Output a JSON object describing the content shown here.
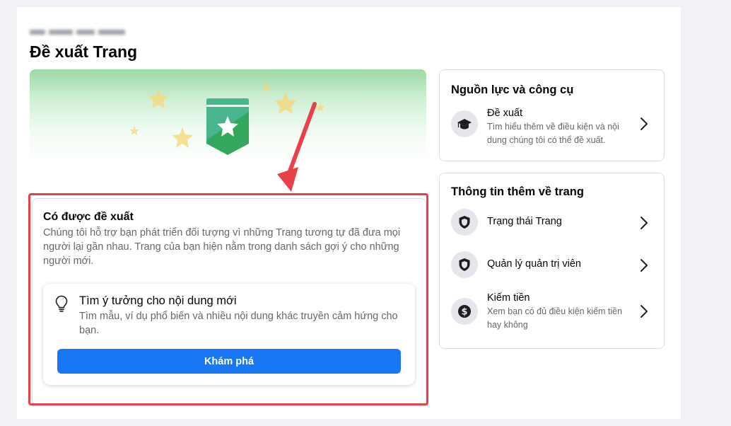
{
  "page": {
    "title": "Đề xuất Trang"
  },
  "main_card": {
    "heading": "Có được đề xuất",
    "description": "Chúng tôi hỗ trợ bạn phát triển đối tượng vì những Trang tương tự đã đưa mọi người lại gần nhau. Trang của bạn hiện nằm trong danh sách gợi ý cho những người mới.",
    "idea": {
      "icon": "lightbulb-icon",
      "title": "Tìm ý tưởng cho nội dung mới",
      "description": "Tìm mẫu, ví dụ phổ biến và nhiều nội dung khác truyền cảm hứng cho bạn.",
      "button_label": "Khám phá"
    }
  },
  "resources_card": {
    "title": "Nguồn lực và công cụ",
    "items": [
      {
        "label": "Đề xuất",
        "description": "Tìm hiểu thêm về điều kiện và nội dung chúng tôi có thể đề xuất.",
        "icon": "graduation-cap-icon"
      }
    ]
  },
  "info_card": {
    "title": "Thông tin thêm về trang",
    "items": [
      {
        "label": "Trạng thái Trang",
        "icon": "shield-icon"
      },
      {
        "label": "Quản lý quản trị viên",
        "icon": "shield-icon"
      },
      {
        "label": "Kiếm tiền",
        "description": "Xem bạn có đủ điều kiện kiếm tiền hay không",
        "icon": "dollar-icon"
      }
    ]
  },
  "colors": {
    "primary": "#1877f2",
    "annotation": "#e8414a",
    "banner_green": "#9cd9a6",
    "badge_green": "#35a65e",
    "star_yellow": "#f7d774"
  }
}
